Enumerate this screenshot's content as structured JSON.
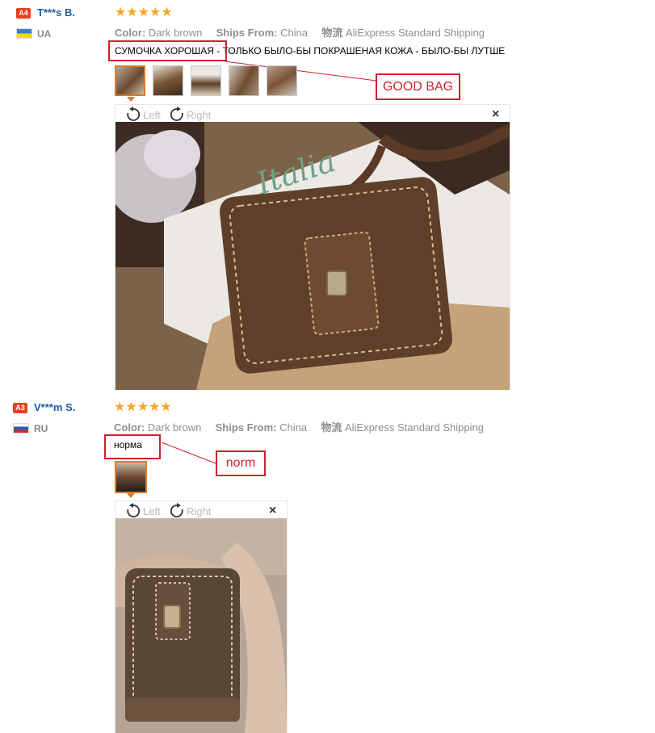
{
  "reviews": [
    {
      "level": "A4",
      "user": "T***s B.",
      "country": "UA",
      "stars": "★★★★★",
      "color_label": "Color:",
      "color_value": "Dark brown",
      "ships_label": "Ships From:",
      "ships_value": "China",
      "shipping_icon": "物流",
      "shipping_value": "AliExpress Standard Shipping",
      "text": "СУМОЧКА ХОРОШАЯ - ТОЛЬКО БЫЛО-БЫ ПОКРАШЕНАЯ КОЖА - БЫЛО-БЫ ЛУТШЕ",
      "annotation": "GOOD BAG",
      "viewer": {
        "left": "Left",
        "right": "Right",
        "close": "×"
      }
    },
    {
      "level": "A3",
      "user": "V***m S.",
      "country": "RU",
      "stars": "★★★★★",
      "color_label": "Color:",
      "color_value": "Dark brown",
      "ships_label": "Ships From:",
      "ships_value": "China",
      "shipping_icon": "物流",
      "shipping_value": "AliExpress Standard Shipping",
      "text": "норма",
      "annotation": "norm",
      "viewer": {
        "left": "Left",
        "right": "Right",
        "close": "×"
      }
    }
  ],
  "colors": {
    "accent_red": "#d0202c",
    "username_blue": "#1d5ba9",
    "star_orange": "#f5a623",
    "badge_red": "#e2421e"
  }
}
